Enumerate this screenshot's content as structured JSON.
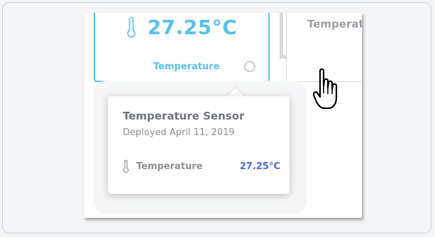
{
  "sensor_card": {
    "value": "27.25°C",
    "label": "Temperature",
    "icon": "thermometer-icon",
    "info_icon": "info-circle-icon"
  },
  "second_card": {
    "title": "Temperature"
  },
  "tooltip": {
    "title": "Temperature Sensor",
    "subtitle": "Deployed April 11, 2019",
    "reading_icon": "thermometer-icon",
    "reading_label": "Temperature",
    "reading_value": "27.25°C"
  },
  "cursor": "hand-pointer-cursor",
  "colors": {
    "accent": "#58c0e8",
    "value_blue": "#4a6bdc",
    "muted_text": "#8b9095"
  }
}
